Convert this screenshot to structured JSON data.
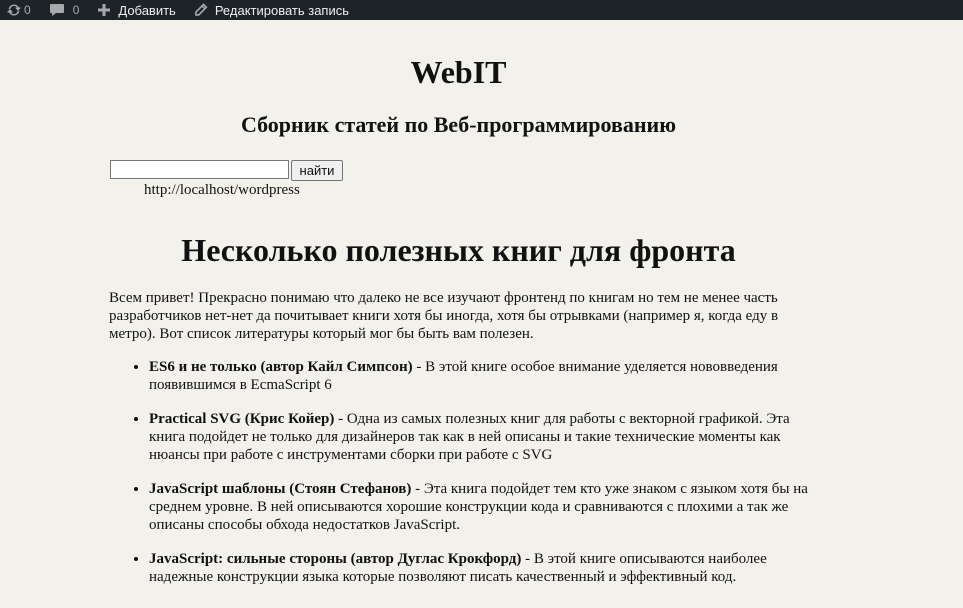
{
  "adminbar": {
    "updates_count": "0",
    "comments_count": "0",
    "add_label": "Добавить",
    "edit_label": "Редактировать запись"
  },
  "header": {
    "site_title": "WebIT",
    "site_description": "Сборник статей по Веб-программированию"
  },
  "search": {
    "value": "",
    "button_label": "найти"
  },
  "site_url": "http://localhost/wordpress",
  "post": {
    "title": "Несколько полезных книг для фронта",
    "intro": "Всем привет! Прекрасно понимаю что далеко не все изучают фронтенд по книгам но тем не менее часть разработчиков нет-нет да почитывает книги хотя бы иногда, хотя бы отрывками (например я, когда еду в метро). Вот список литературы который мог бы быть вам полезен.",
    "books": [
      {
        "title": "ES6 и не только (автор Кайл Симпсон)",
        "text": " - В этой книге особое внимание уделяется нововведения появившимся в EcmaScript 6"
      },
      {
        "title": "Practical SVG (Крис Койер)",
        "text": " - Одна из самых полезных книг для работы с векторной графикой. Эта книга подойдет не только для дизайнеров так как в ней описаны и такие технические моменты как нюансы при работе с инструментами сборки при работе с SVG"
      },
      {
        "title": "JavaScript шаблоны (Стоян Стефанов)",
        "text": " - Эта книга подойдет тем кто уже знаком с языком хотя бы на среднем уровне. В ней описываются хорошие конструкции кода и сравниваются с плохими а так же описаны способы обхода недостатков JavaScript."
      },
      {
        "title": "JavaScript: сильные стороны (автор Дуглас Крокфорд)",
        "text": " - В этой книге описываются наиболее надежные конструкции языка которые позволяют писать качественный и эффективный код."
      }
    ]
  }
}
